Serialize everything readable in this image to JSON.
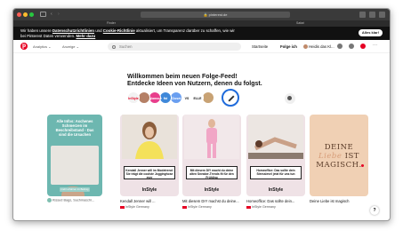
{
  "browser": {
    "url": "pinterest.de",
    "tab_left": "Finder",
    "tab_right": "Safari"
  },
  "cookie_banner": {
    "text_before": "Wir haben unsere",
    "link1": "Datenschutzrichtlinien",
    "text_mid": "und",
    "link2": "Cookie-Richtlinie",
    "text_after": "aktualisiert, um Transparenz darüber zu schaffen, wie wir",
    "line2": "bei Pinterest Daten verwenden.",
    "link3": "Mehr dazu",
    "accept_label": "Alles klar!"
  },
  "nav": {
    "logo": "p",
    "analytics": "Analytics ⌄",
    "ads": "Anzeige ⌄",
    "search_placeholder": "Suchen",
    "home": "Startseite",
    "following": "Folge ich",
    "profile": "Heidis das Kl..."
  },
  "feed_intro": {
    "title": "Willkommen beim neuen Folge-Feed!",
    "subtitle": "Entdecke Ideen von Nutzern, denen du folgst."
  },
  "avatars": [
    {
      "label": "InStyle",
      "color": "#f2f2f2",
      "text_color": "#e60023"
    },
    {
      "label": "",
      "color": "#b58066",
      "text_color": "#ffffff"
    },
    {
      "label": "glamour",
      "color": "#e83e8c",
      "text_color": "#ffffff"
    },
    {
      "label": "ftd",
      "color": "#3f88d9",
      "text_color": "#ffffff"
    },
    {
      "label": "Closet",
      "color": "#6a9ff0",
      "text_color": "#ffffff"
    },
    {
      "label": "VS",
      "color": "#ffffff",
      "text_color": "#111111"
    },
    {
      "label": "ELLE",
      "color": "#ffffff",
      "text_color": "#111111"
    },
    {
      "label": "",
      "color": "#c8a274",
      "text_color": "#ffffff"
    }
  ],
  "pins": [
    {
      "text": "Alle Infos: Aschenes Schmerzen im Beschreibstand - Das sind die Ursachen",
      "button": "mehr erfahren im Beitrag",
      "author": "Kissed Bags, Suchmaschi..."
    },
    {
      "caption": "Kendall Jenner will im Modetrend: Sie trägt die coolste Jogginghose ever",
      "brand": "InStyle",
      "title": "Kendall Jenner will ...",
      "author": "InStyle Germany"
    },
    {
      "caption": "Mit diesem DIY macht du deine alten Sneaker-Trends fit für den Frühling",
      "brand": "InStyle",
      "title": "Mit diesem DIY machst du deine...",
      "author": "InStyle Germany"
    },
    {
      "caption": "Homeoffice: Das sollte dein Stresslevel jetzt für uns tun",
      "brand": "InStyle",
      "title": "Homeoffice: Das sollte dein...",
      "author": "InStyle Germany"
    },
    {
      "quote_line1": "DEINE",
      "quote_line2": "Liebe",
      "quote_line3": "IST",
      "quote_line4": "MAGISCH.",
      "title": "Deine Liebe ist magisch"
    }
  ],
  "help": "?"
}
